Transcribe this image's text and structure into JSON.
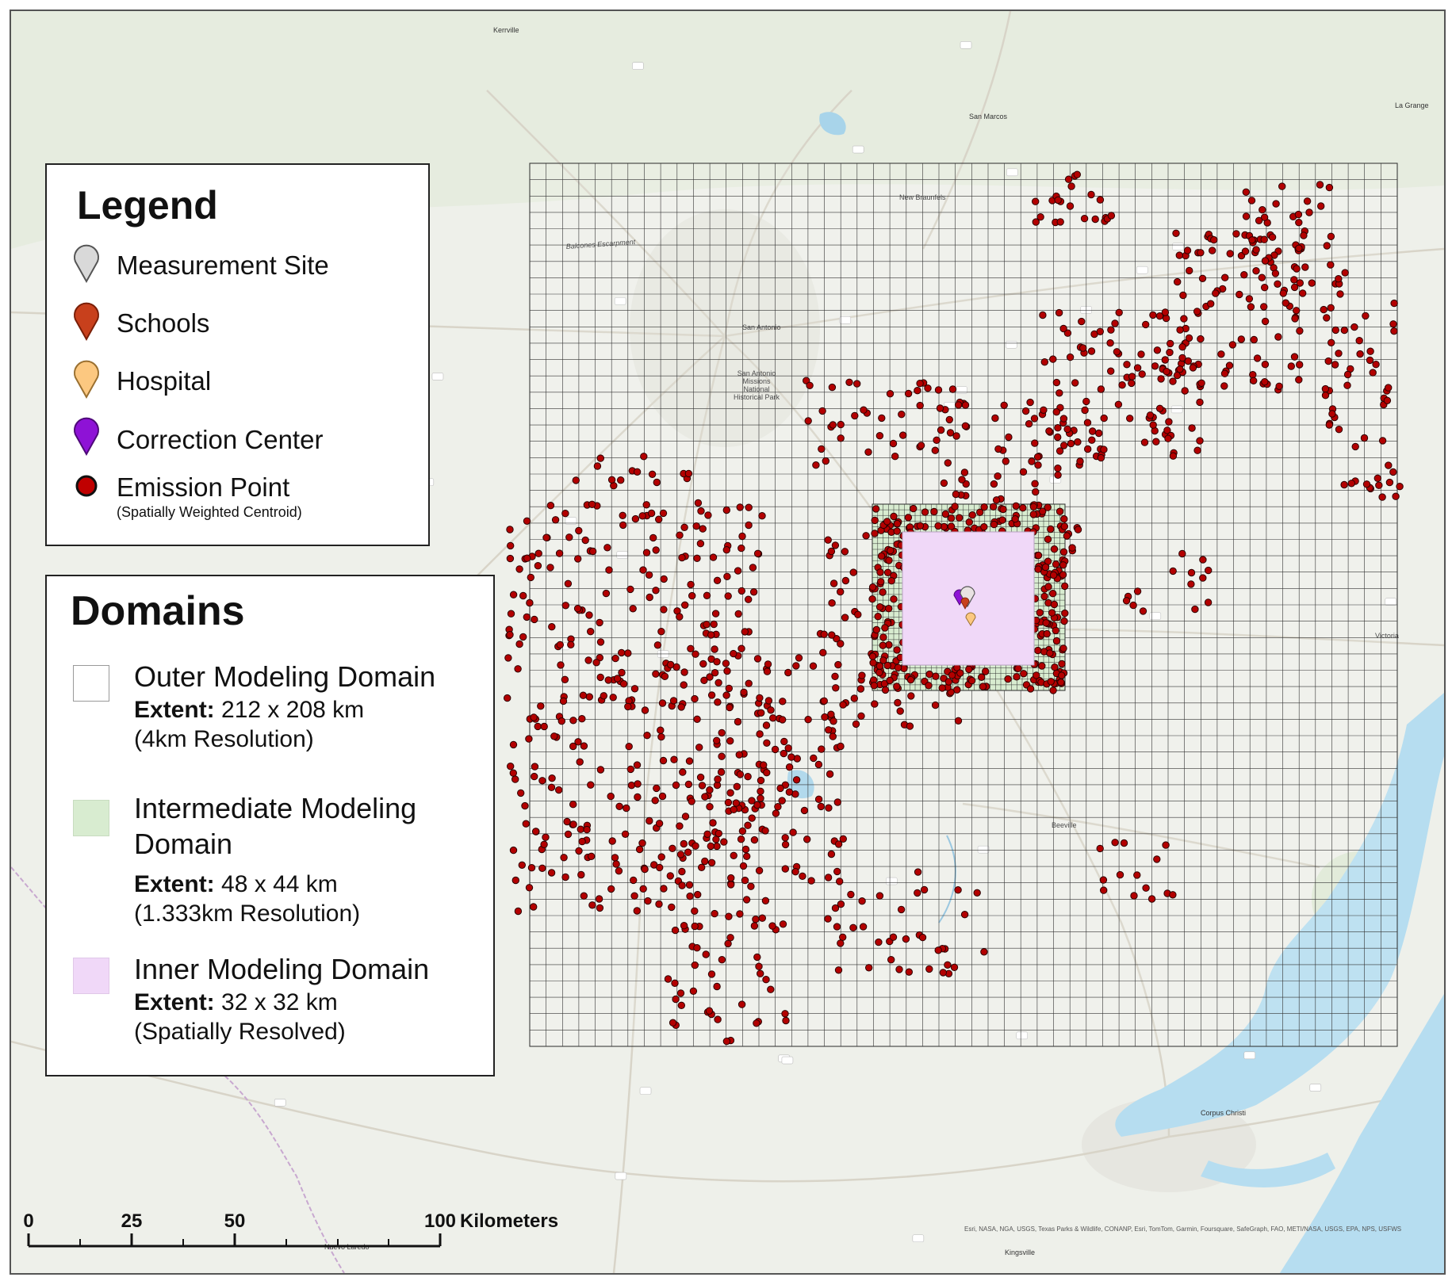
{
  "legend": {
    "title": "Legend",
    "items": [
      {
        "label": "Measurement Site",
        "icon": "gray-pin-icon",
        "color": "#d9d9d9"
      },
      {
        "label": "Schools",
        "icon": "red-pin-icon",
        "color": "#c8401c"
      },
      {
        "label": "Hospital",
        "icon": "orange-pin-icon",
        "color": "#fcc880"
      },
      {
        "label": "Correction Center",
        "icon": "purple-pin-icon",
        "color": "#8e12d6"
      },
      {
        "label": "Emission Point",
        "sublabel": "(Spatially Weighted Centroid)",
        "icon": "red-dot-icon",
        "color": "#c00000"
      }
    ]
  },
  "domains": {
    "title": "Domains",
    "items": [
      {
        "name": "Outer Modeling Domain",
        "extent_label": "Extent:",
        "extent": "212 x 208 km",
        "resolution": "(4km Resolution)",
        "color": "#ffffff"
      },
      {
        "name": "Intermediate Modeling Domain",
        "extent_label": "Extent:",
        "extent": "48 x 44 km",
        "resolution": "(1.333km Resolution)",
        "color": "#d8ecd0"
      },
      {
        "name": "Inner Modeling Domain",
        "extent_label": "Extent:",
        "extent": "32 x 32 km",
        "resolution": "(Spatially Resolved)",
        "color": "#f0d8f8"
      }
    ]
  },
  "scalebar": {
    "ticks": [
      "0",
      "25",
      "50",
      "100"
    ],
    "unit": "Kilometers"
  },
  "credits": "Esri, NASA, NGA, USGS, Texas Parks & Wildlife, CONANP, Esri, TomTom, Garmin, Foursquare, SafeGraph, FAO, METI/NASA, USGS, EPA, NPS, USFWS",
  "places": [
    "Kerrville",
    "San Marcos",
    "La Grange",
    "New Braunfels",
    "San Antonio",
    "San Antonio Missions National Historical Park",
    "Balcones Escarpment",
    "Victoria",
    "Beeville",
    "Corpus Christi",
    "Kingsville",
    "Nuevo Laredo"
  ]
}
